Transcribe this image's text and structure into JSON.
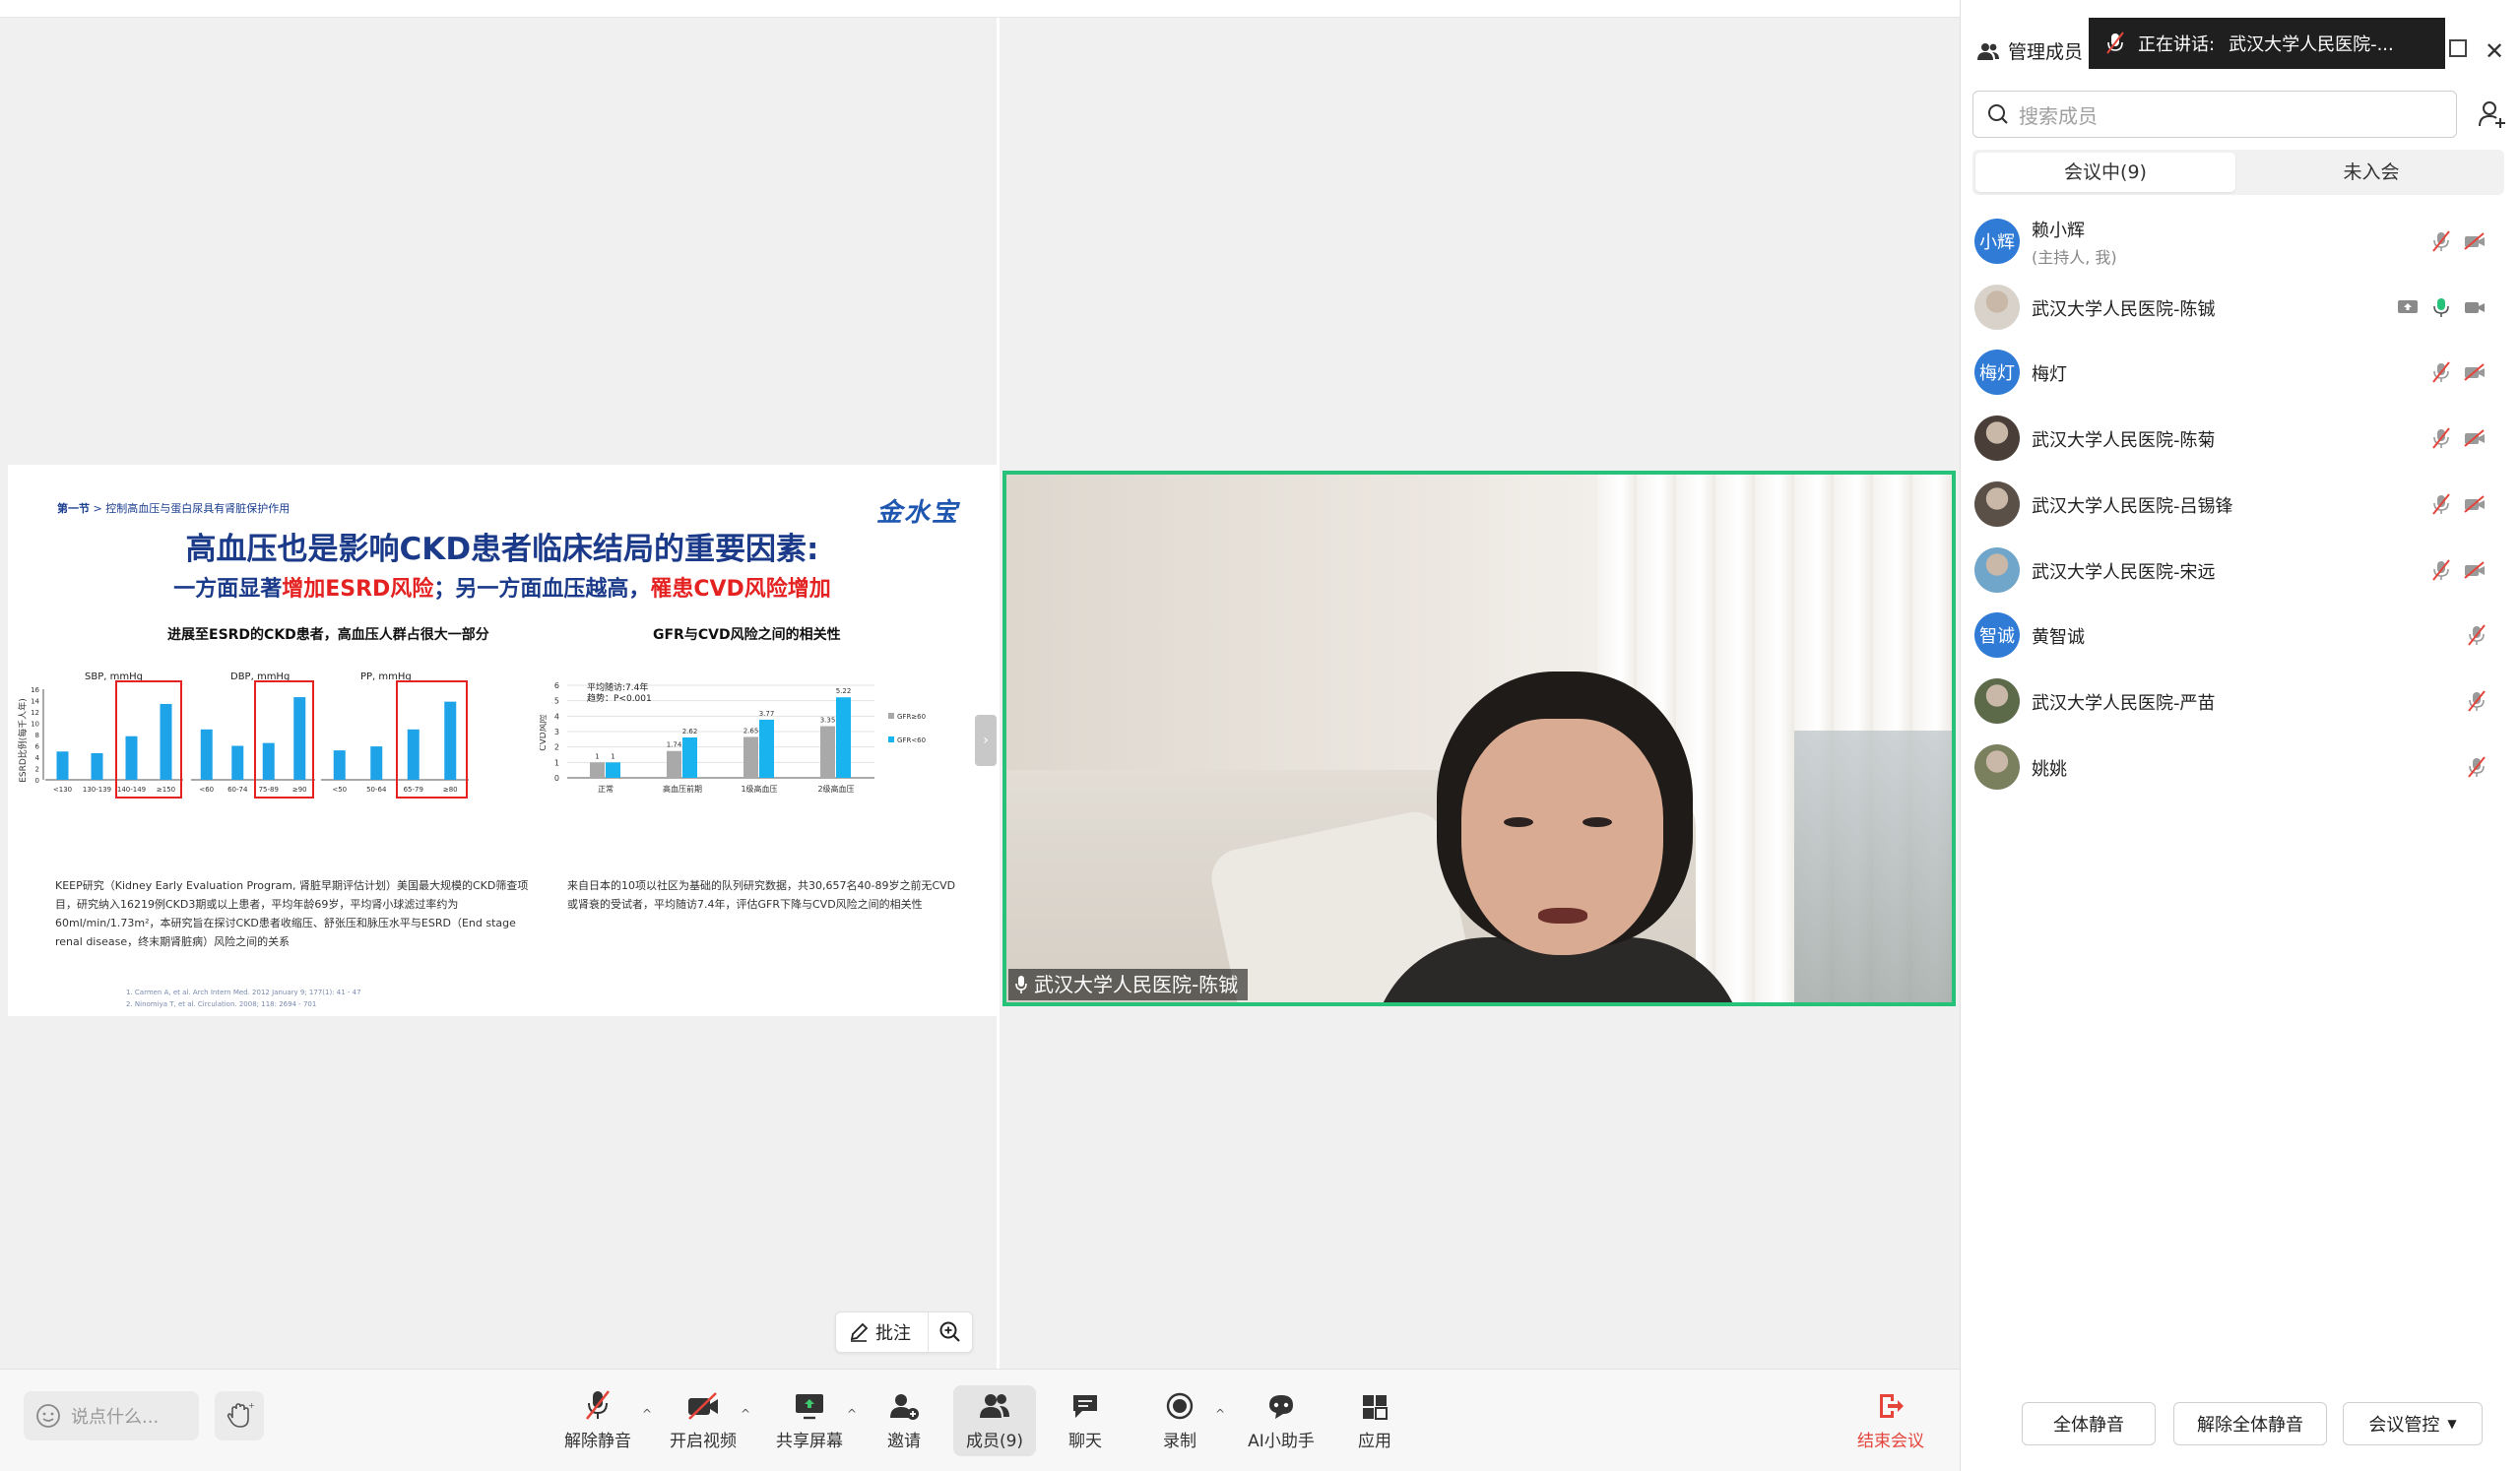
{
  "slide": {
    "section_label": "第一节",
    "section_text": " > 控制高血压与蛋白尿具有肾脏保护作用",
    "brand": "金水宝",
    "title": "高血压也是影响CKD患者临床结局的重要因素:",
    "subtitle_a": "一方面显著",
    "subtitle_b": "增加ESRD风险",
    "subtitle_c": "；另一方面血压越高，",
    "subtitle_d": "罹患CVD风险增加",
    "chart1_title": "进展至ESRD的CKD患者，高血压人群占很大一部分",
    "chart2_title": "GFR与CVD风险之间的相关性",
    "caption1": "KEEP研究（Kidney Early Evaluation Program, 肾脏早期评估计划）美国最大规模的CKD筛查项目，研究纳入16219例CKD3期或以上患者，平均年龄69岁，平均肾小球滤过率约为60ml/min/1.73m²，本研究旨在探讨CKD患者收缩压、舒张压和脉压水平与ESRD（End stage renal disease，终末期肾脏病）风险之间的关系",
    "caption2": "来自日本的10项以社区为基础的队列研究数据，共30,657名40-89岁之前无CVD或肾衰的受试者，平均随访7.4年，评估GFR下降与CVD风险之间的相关性",
    "ref1": "1.    Carmen A, et al. Arch Intern Med. 2012 January 9; 177(1): 41 - 47",
    "ref2": "2.    Ninomiya T, et al. Circulation. 2008; 118: 2694 - 701"
  },
  "chart_data": [
    {
      "type": "bar",
      "title": "进展至ESRD的CKD患者，高血压人群占很大一部分",
      "ylabel": "ESRD比例(每千人年)",
      "ylim": [
        0,
        16
      ],
      "yticks": [
        0,
        2,
        4,
        6,
        8,
        10,
        12,
        14,
        16
      ],
      "panels": [
        {
          "name": "SBP, mmHg",
          "categories": [
            "<130",
            "130-139",
            "140-149",
            "≥150"
          ],
          "values": [
            5,
            4.7,
            7.7,
            13.4
          ],
          "highlighted": [
            "140-149",
            "≥150"
          ]
        },
        {
          "name": "DBP, mmHg",
          "categories": [
            "<60",
            "60-74",
            "75-89",
            "≥90"
          ],
          "values": [
            8.9,
            6,
            6.5,
            14.6
          ],
          "highlighted": [
            "75-89",
            "≥90"
          ]
        },
        {
          "name": "PP, mmHg",
          "categories": [
            "<50",
            "50-64",
            "65-79",
            "≥80"
          ],
          "values": [
            5.2,
            5.9,
            8.9,
            13.8
          ],
          "highlighted": [
            "65-79",
            "≥80"
          ]
        }
      ],
      "color": "#1fa3e8"
    },
    {
      "type": "bar",
      "title": "GFR与CVD风险之间的相关性",
      "ylabel": "CVD风险",
      "ylim": [
        0,
        6
      ],
      "yticks": [
        0,
        1,
        2,
        3,
        4,
        5,
        6
      ],
      "categories": [
        "正常",
        "高血压前期",
        "1级高血压",
        "2级高血压"
      ],
      "series": [
        {
          "name": "GFR≥60",
          "values": [
            1,
            1.74,
            2.65,
            3.35
          ],
          "color": "#a9a9a9"
        },
        {
          "name": "GFR<60",
          "values": [
            1,
            2.62,
            3.77,
            5.22
          ],
          "color": "#19b4f0"
        }
      ],
      "annotation": [
        "平均随访:7.4年",
        "趋势：P<0.001"
      ],
      "legend": "right"
    }
  ],
  "video": {
    "name": "武汉大学人民医院-陈铖",
    "border_color": "#27c27a"
  },
  "annotation_bar": {
    "annotate_label": "批注"
  },
  "toolbar": {
    "chat_placeholder": "说点什么...",
    "items": [
      {
        "label": "解除静音",
        "icon": "mic-muted-icon"
      },
      {
        "label": "开启视频",
        "icon": "video-off-icon"
      },
      {
        "label": "共享屏幕",
        "icon": "share-screen-icon"
      },
      {
        "label": "邀请",
        "icon": "invite-icon"
      },
      {
        "label": "成员(9)",
        "icon": "members-icon"
      },
      {
        "label": "聊天",
        "icon": "chat-icon"
      },
      {
        "label": "录制",
        "icon": "record-icon"
      },
      {
        "label": "AI小助手",
        "icon": "ai-assistant-icon"
      },
      {
        "label": "应用",
        "icon": "apps-icon"
      }
    ],
    "end_label": "结束会议",
    "end_color": "#e5443b"
  },
  "panel": {
    "title": "管理成员",
    "speaking_prefix": "正在讲话:",
    "speaking_name": "武汉大学人民医院-...",
    "search_placeholder": "搜索成员",
    "tab_in_meeting": "会议中(9)",
    "tab_not_joined": "未入会",
    "members": [
      {
        "name": "赖小辉",
        "role": "(主持人, 我)",
        "avatar": "小辉",
        "avatar_color": "#2f7bd6"
      },
      {
        "name": "武汉大学人民医院-陈铖",
        "role": "",
        "avatar": "",
        "avatar_color": "#d8d2cb"
      },
      {
        "name": "梅灯",
        "role": "",
        "avatar": "梅灯",
        "avatar_color": "#2f7bd6"
      },
      {
        "name": "武汉大学人民医院-陈菊",
        "role": "",
        "avatar": "",
        "avatar_color": "#4a3f38"
      },
      {
        "name": "武汉大学人民医院-吕锡锋",
        "role": "",
        "avatar": "",
        "avatar_color": "#5a5048"
      },
      {
        "name": "武汉大学人民医院-宋远",
        "role": "",
        "avatar": "",
        "avatar_color": "#6fa6c9"
      },
      {
        "name": "黄智诚",
        "role": "",
        "avatar": "智诚",
        "avatar_color": "#2f7bd6"
      },
      {
        "name": "武汉大学人民医院-严苗",
        "role": "",
        "avatar": "",
        "avatar_color": "#5c6a4a"
      },
      {
        "name": "姚姚",
        "role": "",
        "avatar": "",
        "avatar_color": "#7a7f5e"
      }
    ],
    "mute_all": "全体静音",
    "unmute_all": "解除全体静音",
    "meeting_control": "会议管控"
  }
}
